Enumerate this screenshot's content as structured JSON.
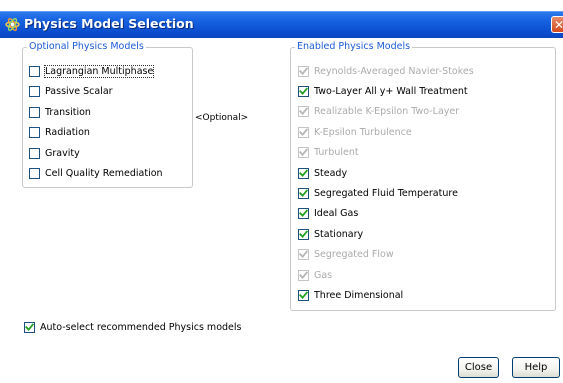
{
  "window": {
    "title": "Physics Model Selection"
  },
  "optional": {
    "legend": "Optional Physics Models",
    "items": [
      {
        "label": "Lagrangian Multiphase",
        "checked": false,
        "focused": true
      },
      {
        "label": "Passive Scalar",
        "checked": false
      },
      {
        "label": "Transition",
        "checked": false
      },
      {
        "label": "Radiation",
        "checked": false
      },
      {
        "label": "Gravity",
        "checked": false
      },
      {
        "label": "Cell Quality Remediation",
        "checked": false
      }
    ]
  },
  "center_label": "<Optional>",
  "enabled": {
    "legend": "Enabled Physics Models",
    "items": [
      {
        "label": "Reynolds-Averaged Navier-Stokes",
        "checked": true,
        "enabled": false
      },
      {
        "label": "Two-Layer All y+ Wall Treatment",
        "checked": true,
        "enabled": true
      },
      {
        "label": "Realizable K-Epsilon Two-Layer",
        "checked": true,
        "enabled": false
      },
      {
        "label": "K-Epsilon Turbulence",
        "checked": true,
        "enabled": false
      },
      {
        "label": "Turbulent",
        "checked": true,
        "enabled": false
      },
      {
        "label": "Steady",
        "checked": true,
        "enabled": true
      },
      {
        "label": "Segregated Fluid Temperature",
        "checked": true,
        "enabled": true
      },
      {
        "label": "Ideal Gas",
        "checked": true,
        "enabled": true
      },
      {
        "label": "Stationary",
        "checked": true,
        "enabled": true
      },
      {
        "label": "Segregated Flow",
        "checked": true,
        "enabled": false
      },
      {
        "label": "Gas",
        "checked": true,
        "enabled": false
      },
      {
        "label": "Three Dimensional",
        "checked": true,
        "enabled": true
      }
    ]
  },
  "auto_select": {
    "label": "Auto-select recommended Physics models",
    "checked": true
  },
  "buttons": {
    "close": "Close",
    "help": "Help"
  },
  "colors": {
    "title_bar": "#0b4fd0",
    "legend_text": "#1d5bd6",
    "check_mark": "#21a121",
    "disabled_check": "#b5b5b5",
    "disabled_text": "#ababab"
  },
  "icons": {
    "title": "atom-icon",
    "close": "close-icon",
    "check": "check-icon"
  }
}
